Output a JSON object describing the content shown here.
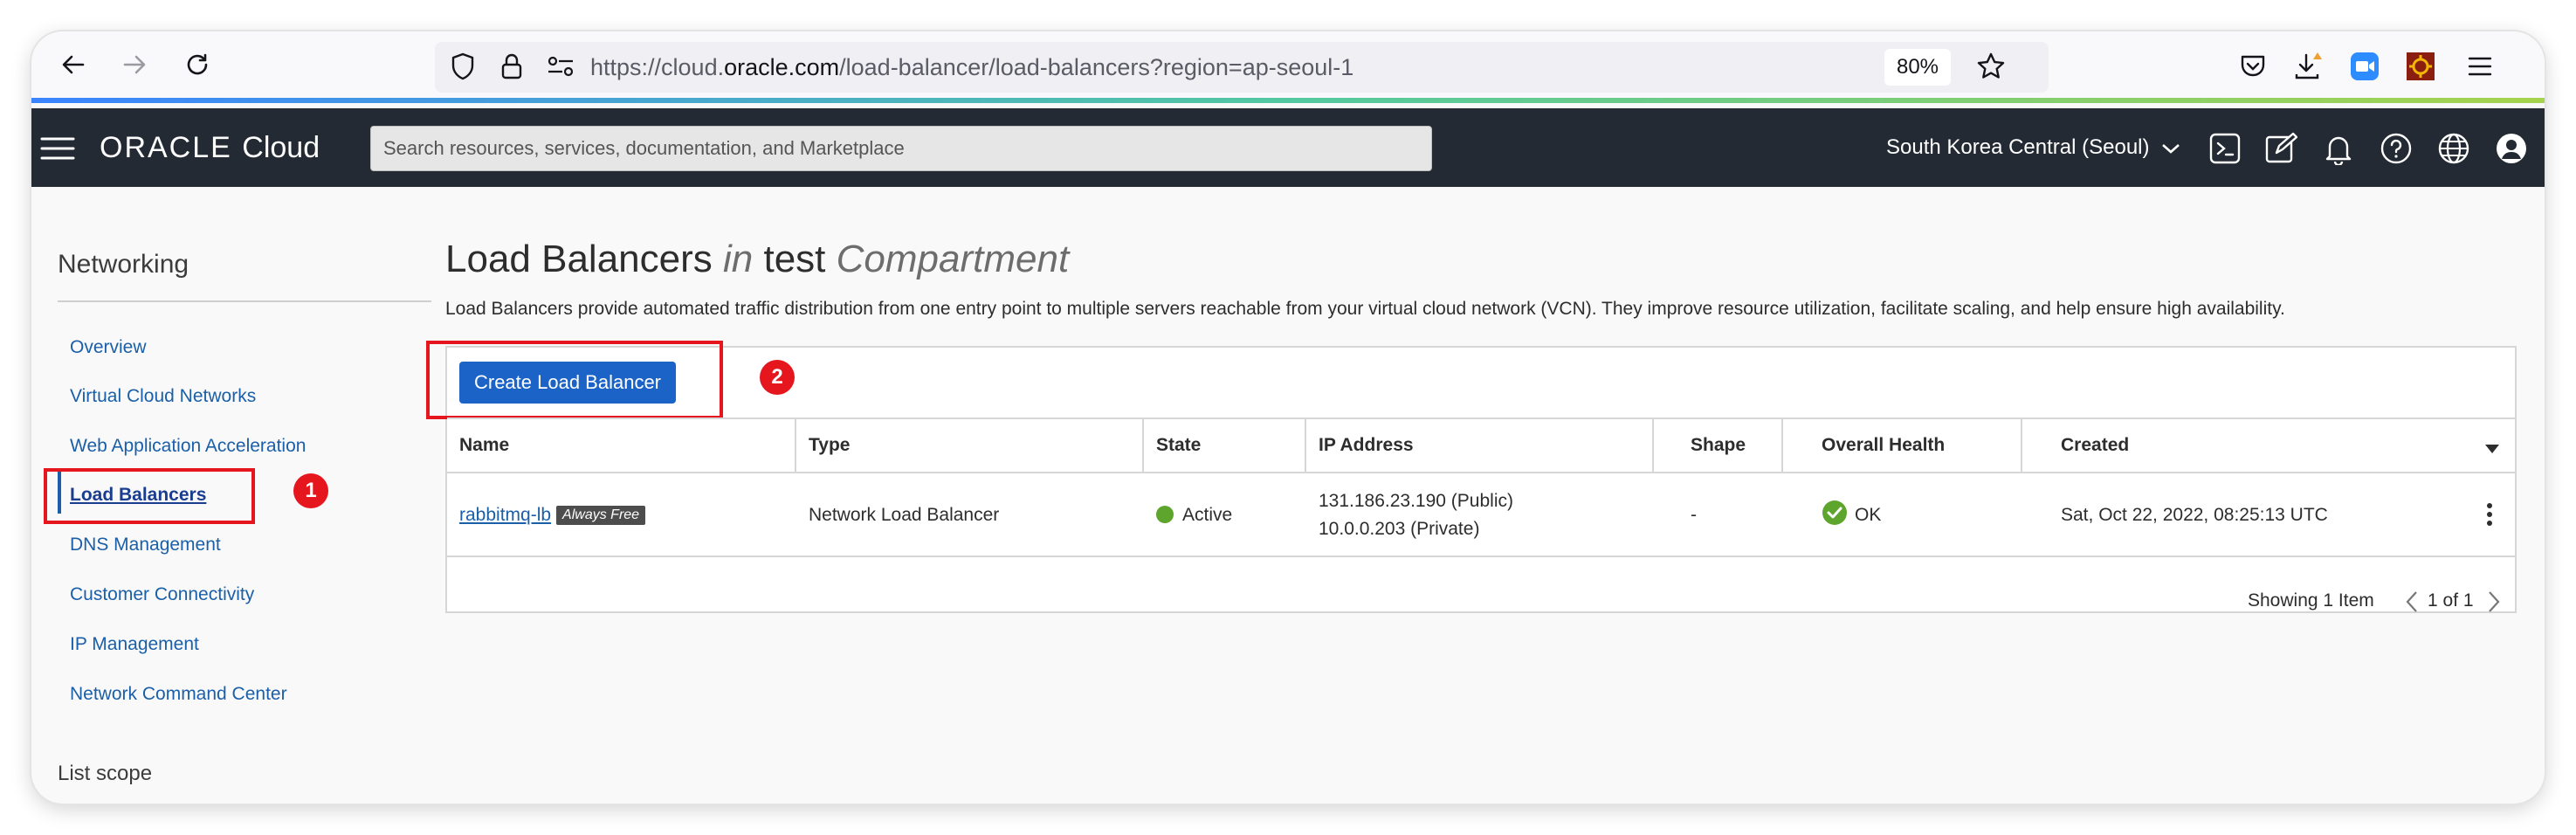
{
  "browser": {
    "url_prefix": "https://cloud.",
    "url_host": "oracle.com",
    "url_path": "/load-balancer/load-balancers?region=ap-seoul-1",
    "zoom": "80%"
  },
  "header": {
    "brand": "ORACLE",
    "brand_suffix": "Cloud",
    "search_placeholder": "Search resources, services, documentation, and Marketplace",
    "region": "South Korea Central (Seoul)"
  },
  "sidebar": {
    "title": "Networking",
    "items": [
      {
        "label": "Overview"
      },
      {
        "label": "Virtual Cloud Networks"
      },
      {
        "label": "Web Application Acceleration"
      },
      {
        "label": "Load Balancers"
      },
      {
        "label": "DNS Management"
      },
      {
        "label": "Customer Connectivity"
      },
      {
        "label": "IP Management"
      },
      {
        "label": "Network Command Center"
      }
    ],
    "list_scope": "List scope"
  },
  "annotations": {
    "one": "1",
    "two": "2"
  },
  "main": {
    "title_part1": "Load Balancers",
    "title_in": "in",
    "title_compartment": "test",
    "title_suffix": "Compartment",
    "description": "Load Balancers provide automated traffic distribution from one entry point to multiple servers reachable from your virtual cloud network (VCN). They improve resource utilization, facilitate scaling, and help ensure high availability.",
    "create_button": "Create Load Balancer",
    "columns": [
      "Name",
      "Type",
      "State",
      "IP Address",
      "Shape",
      "Overall Health",
      "Created"
    ],
    "rows": [
      {
        "name": "rabbitmq-lb",
        "badge": "Always Free",
        "type": "Network Load Balancer",
        "state": "Active",
        "ip_public": "131.186.23.190 (Public)",
        "ip_private": "10.0.0.203 (Private)",
        "shape": "-",
        "health": "OK",
        "created": "Sat, Oct 22, 2022, 08:25:13 UTC"
      }
    ],
    "showing": "Showing 1 Item",
    "pagination": "1 of 1"
  },
  "colors": {
    "header_bg": "#232a33",
    "primary_button": "#1b63c6",
    "link": "#1a5fa8",
    "active_state": "#5ea52d",
    "annotation": "#e5161d"
  }
}
